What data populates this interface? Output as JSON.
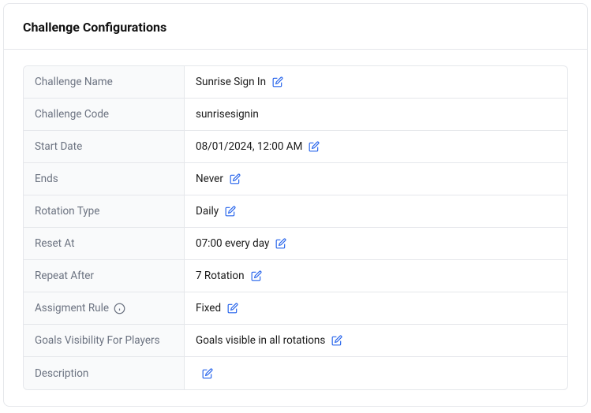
{
  "header": {
    "title": "Challenge Configurations"
  },
  "rows": [
    {
      "label": "Challenge Name",
      "value": "Sunrise Sign In",
      "editable": true,
      "info": false
    },
    {
      "label": "Challenge Code",
      "value": "sunrisesignin",
      "editable": false,
      "info": false
    },
    {
      "label": "Start Date",
      "value": "08/01/2024, 12:00 AM",
      "editable": true,
      "info": false
    },
    {
      "label": "Ends",
      "value": "Never",
      "editable": true,
      "info": false
    },
    {
      "label": "Rotation Type",
      "value": "Daily",
      "editable": true,
      "info": false
    },
    {
      "label": "Reset At",
      "value": "07:00 every day",
      "editable": true,
      "info": false
    },
    {
      "label": "Repeat After",
      "value": "7 Rotation",
      "editable": true,
      "info": false
    },
    {
      "label": "Assigment Rule",
      "value": "Fixed",
      "editable": true,
      "info": true
    },
    {
      "label": "Goals Visibility For Players",
      "value": "Goals visible in all rotations",
      "editable": true,
      "info": false
    },
    {
      "label": "Description",
      "value": "",
      "editable": true,
      "info": false
    }
  ]
}
